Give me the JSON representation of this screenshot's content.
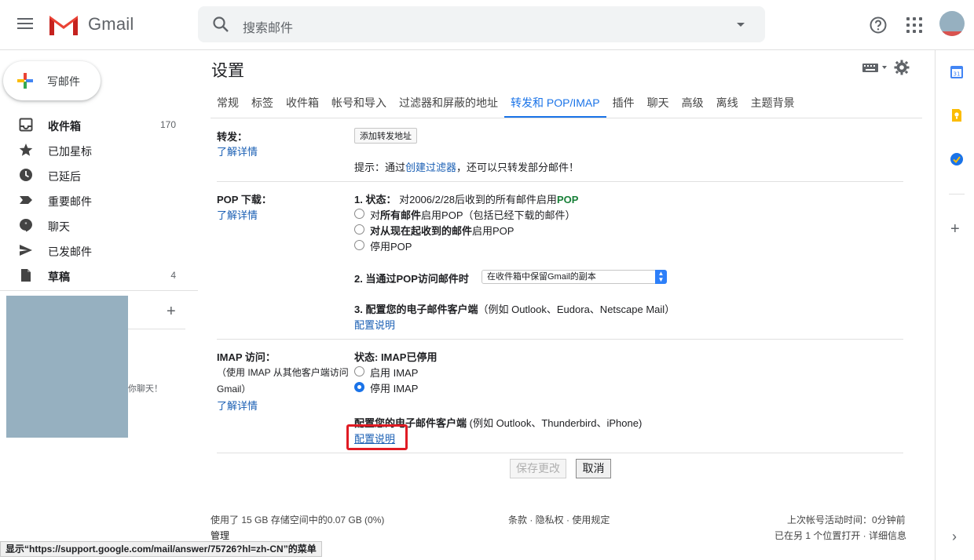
{
  "header": {
    "app_name": "Gmail",
    "search_placeholder": "搜索邮件"
  },
  "sidebar": {
    "compose_label": "写邮件",
    "items": [
      {
        "label": "收件箱",
        "count": "170",
        "icon": "inbox-icon",
        "bold": true
      },
      {
        "label": "已加星标",
        "count": "",
        "icon": "star-icon",
        "bold": false
      },
      {
        "label": "已延后",
        "count": "",
        "icon": "clock-icon",
        "bold": false
      },
      {
        "label": "重要邮件",
        "count": "",
        "icon": "important-icon",
        "bold": false
      },
      {
        "label": "聊天",
        "count": "",
        "icon": "chat-icon",
        "bold": false
      },
      {
        "label": "已发邮件",
        "count": "",
        "icon": "send-icon",
        "bold": false
      },
      {
        "label": "草稿",
        "count": "4",
        "icon": "draft-icon",
        "bold": true
      }
    ],
    "chat_text": "你聊天！"
  },
  "main": {
    "title": "设置",
    "tabs": [
      {
        "label": "常规",
        "active": false
      },
      {
        "label": "标签",
        "active": false
      },
      {
        "label": "收件箱",
        "active": false
      },
      {
        "label": "帐号和导入",
        "active": false
      },
      {
        "label": "过滤器和屏蔽的地址",
        "active": false
      },
      {
        "label": "转发和 POP/IMAP",
        "active": true
      },
      {
        "label": "插件",
        "active": false
      },
      {
        "label": "聊天",
        "active": false
      },
      {
        "label": "高级",
        "active": false
      },
      {
        "label": "离线",
        "active": false
      },
      {
        "label": "主题背景",
        "active": false
      }
    ],
    "forwarding": {
      "label": "转发：",
      "learn_more": "了解详情",
      "add_button": "添加转发地址",
      "tip_prefix": "提示：通过",
      "tip_link": "创建过滤器",
      "tip_suffix": "，还可以只转发部分邮件！"
    },
    "pop": {
      "label": "POP 下载：",
      "learn_more": "了解详情",
      "status_label": "1. 状态：",
      "status_text": "对2006/2/28后收到的所有邮件启用",
      "status_value": "POP",
      "option1_prefix": "对",
      "option1_bold": "所有邮件",
      "option1_suffix": "启用POP（包括已经下载的邮件）",
      "option2_bold": "对从现在起收到的邮件",
      "option2_suffix": "启用POP",
      "option3": "停用POP",
      "when_label": "2. 当通过POP访问邮件时",
      "when_select": "在收件箱中保留Gmail的副本",
      "config_label": "3. 配置您的电子邮件客户端",
      "config_suffix": "（例如 Outlook、Eudora、Netscape Mail）",
      "config_link": "配置说明"
    },
    "imap": {
      "label": "IMAP 访问：",
      "desc1": "（使用 IMAP 从其他客户端访问",
      "desc2": "Gmail）",
      "learn_more": "了解详情",
      "status": "状态: IMAP已停用",
      "enable": "启用 IMAP",
      "disable": "停用 IMAP",
      "config_bold": "配置您的电子邮件客户端",
      "config_suffix": " (例如 Outlook、Thunderbird、iPhone)",
      "config_link": "配置说明"
    },
    "save_button": "保存更改",
    "cancel_button": "取消"
  },
  "footer": {
    "storage": "使用了 15 GB 存储空间中的0.07 GB (0%)",
    "manage": "管理",
    "links": "条款 · 隐私权 · 使用规定",
    "last_activity": "上次帐号活动时间：0分钟前",
    "other_location": "已在另 1 个位置打开 · 详细信息"
  },
  "statusbar": "显示“https://support.google.com/mail/answer/75726?hl=zh-CN”的菜单",
  "colors": {
    "accent": "#1a73e8",
    "link": "#1a5fb4",
    "pop_green": "#188038",
    "highlight": "#e01b24"
  }
}
